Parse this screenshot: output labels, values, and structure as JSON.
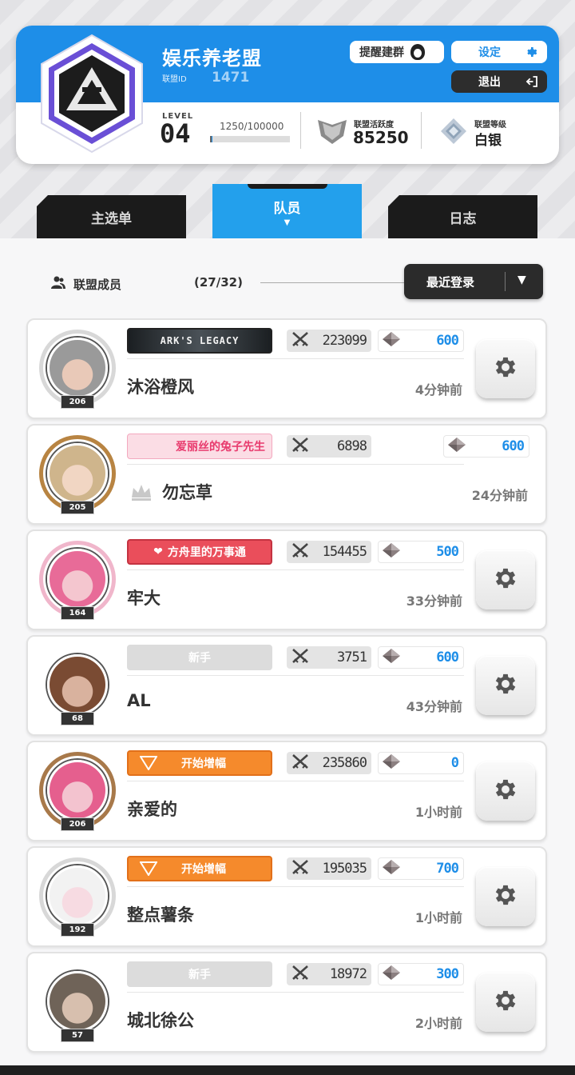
{
  "guild": {
    "name": "娱乐养老盟",
    "id_label": "联盟ID",
    "id_value": "1471",
    "level_label": "LEVEL",
    "level_value": "04",
    "exp": "1250/100000",
    "exp_fraction": 0.0125,
    "activity_label": "联盟活跃度",
    "activity_value": "85250",
    "rank_label": "联盟等级",
    "rank_value": "白银"
  },
  "buttons": {
    "remind": "提醒建群",
    "settings": "设定",
    "logout": "退出"
  },
  "tabs": [
    {
      "label": "主选单",
      "active": false
    },
    {
      "label": "队员",
      "active": true
    },
    {
      "label": "日志",
      "active": false
    }
  ],
  "members_header": {
    "label": "联盟成员",
    "count": "(27/32)",
    "sort": "最近登录"
  },
  "members": [
    {
      "name": "沐浴橙风",
      "level": "206",
      "badge": "ARK'S LEGACY",
      "badge_style": "ark",
      "power": "223099",
      "points": "600",
      "last_login": "4分钟前",
      "has_gear": true,
      "crown": false,
      "frame_color": "#d8d8d8"
    },
    {
      "name": "勿忘草",
      "level": "205",
      "badge": "爱丽丝的兔子先生",
      "badge_style": "pink",
      "power": "6898",
      "points": "600",
      "last_login": "24分钟前",
      "has_gear": false,
      "crown": true,
      "frame_color": "#b88442"
    },
    {
      "name": "牢大",
      "level": "164",
      "badge": "方舟里的万事通",
      "badge_style": "red",
      "power": "154455",
      "points": "500",
      "last_login": "33分钟前",
      "has_gear": true,
      "crown": false,
      "frame_color": "#f0b6cb"
    },
    {
      "name": "AL",
      "level": "68",
      "badge": "新手",
      "badge_style": "gray",
      "power": "3751",
      "points": "600",
      "last_login": "43分钟前",
      "has_gear": true,
      "crown": false,
      "frame_color": "#ffffff"
    },
    {
      "name": "亲爱的",
      "level": "206",
      "badge": "开始增幅",
      "badge_style": "orange",
      "power": "235860",
      "points": "0",
      "last_login": "1小时前",
      "has_gear": true,
      "crown": false,
      "frame_color": "#a8794a"
    },
    {
      "name": "整点薯条",
      "level": "192",
      "badge": "开始增幅",
      "badge_style": "orange",
      "power": "195035",
      "points": "700",
      "last_login": "1小时前",
      "has_gear": true,
      "crown": false,
      "frame_color": "#d8d8d8"
    },
    {
      "name": "城北徐公",
      "level": "57",
      "badge": "新手",
      "badge_style": "gray",
      "power": "18972",
      "points": "300",
      "last_login": "2小时前",
      "has_gear": true,
      "crown": false,
      "frame_color": "#ffffff"
    }
  ],
  "colors": {
    "accent_blue": "#1e8ee8",
    "tab_active": "#23a0ec",
    "dark": "#1b1b1b"
  }
}
